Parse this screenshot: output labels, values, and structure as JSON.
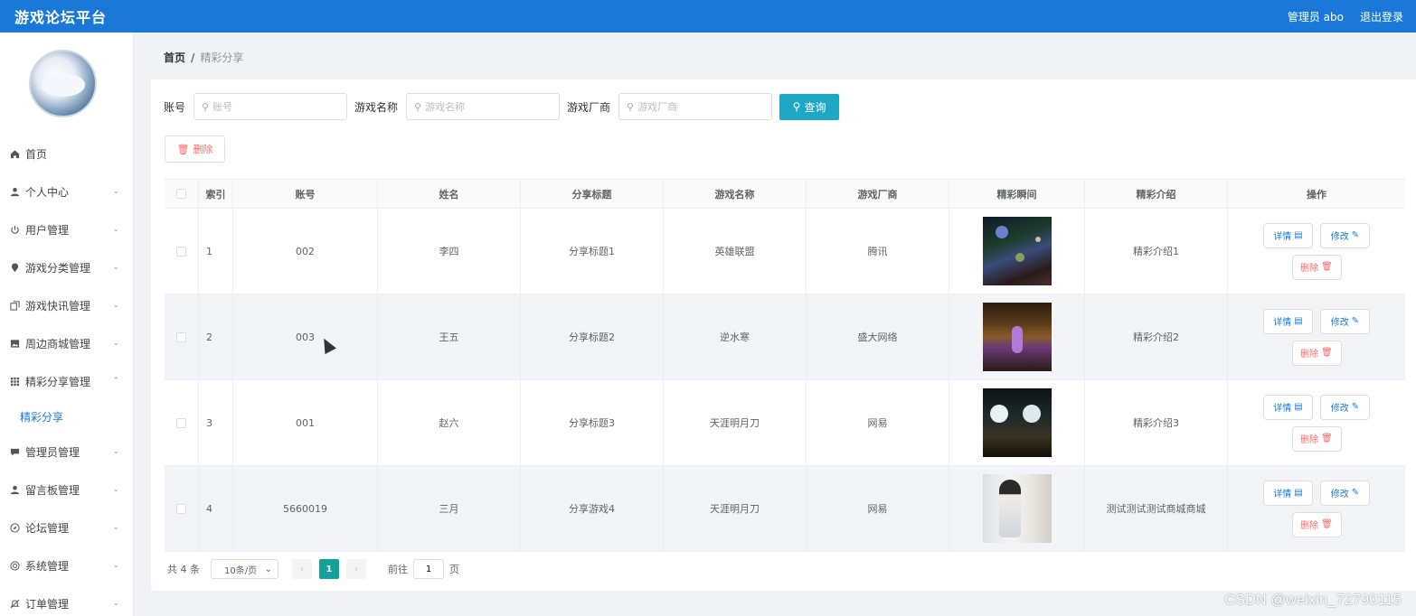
{
  "header": {
    "app_title": "游戏论坛平台",
    "user_label": "管理员 abo",
    "logout_label": "退出登录",
    "bg_color": "#1a79d8"
  },
  "sidebar": {
    "menu": [
      {
        "label": "首页",
        "icon": "home-icon"
      },
      {
        "label": "个人中心",
        "icon": "user-icon"
      },
      {
        "label": "用户管理",
        "icon": "power-icon"
      },
      {
        "label": "游戏分类管理",
        "icon": "location-icon"
      },
      {
        "label": "游戏快讯管理",
        "icon": "copy-icon"
      },
      {
        "label": "周边商城管理",
        "icon": "picture-icon"
      },
      {
        "label": "精彩分享管理",
        "icon": "grid-icon"
      },
      {
        "label": "管理员管理",
        "icon": "chat-icon"
      },
      {
        "label": "留言板管理",
        "icon": "user-icon"
      },
      {
        "label": "论坛管理",
        "icon": "compass-icon"
      },
      {
        "label": "系统管理",
        "icon": "settings-icon"
      },
      {
        "label": "订单管理",
        "icon": "bell-icon"
      }
    ],
    "active_submenu": "精彩分享",
    "active_color": "#1a79d8"
  },
  "breadcrumb": {
    "home": "首页",
    "separator": "/",
    "current": "精彩分享"
  },
  "search": {
    "account_label": "账号",
    "account_placeholder": "账号",
    "game_label": "游戏名称",
    "game_placeholder": "游戏名称",
    "vendor_label": "游戏厂商",
    "vendor_placeholder": "游戏厂商",
    "query_label": "查询",
    "query_color": "#1ea7c5"
  },
  "toolbar": {
    "delete_label": "删除"
  },
  "table": {
    "columns": [
      "索引",
      "账号",
      "姓名",
      "分享标题",
      "游戏名称",
      "游戏厂商",
      "精彩瞬间",
      "精彩介绍",
      "操作"
    ],
    "rows": [
      {
        "index": "1",
        "account": "002",
        "name": "李四",
        "title": "分享标题1",
        "game": "英雄联盟",
        "vendor": "腾讯",
        "intro": "精彩介绍1"
      },
      {
        "index": "2",
        "account": "003",
        "name": "王五",
        "title": "分享标题2",
        "game": "逆水寒",
        "vendor": "盛大网络",
        "intro": "精彩介绍2"
      },
      {
        "index": "3",
        "account": "001",
        "name": "赵六",
        "title": "分享标题3",
        "game": "天涯明月刀",
        "vendor": "网易",
        "intro": "精彩介绍3"
      },
      {
        "index": "4",
        "account": "5660019",
        "name": "三月",
        "title": "分享游戏4",
        "game": "天涯明月刀",
        "vendor": "网易",
        "intro": "测试测试测试商城商城"
      }
    ],
    "actions": {
      "detail": "详情",
      "edit": "修改",
      "delete": "删除"
    }
  },
  "pagination": {
    "total": "共 4 条",
    "page_size": "10条/页",
    "current_page": "1",
    "goto_label": "前往",
    "goto_value": "1",
    "page_suffix": "页",
    "active_color": "#13a19b"
  },
  "watermark": "CSDN @weixin_72790115"
}
